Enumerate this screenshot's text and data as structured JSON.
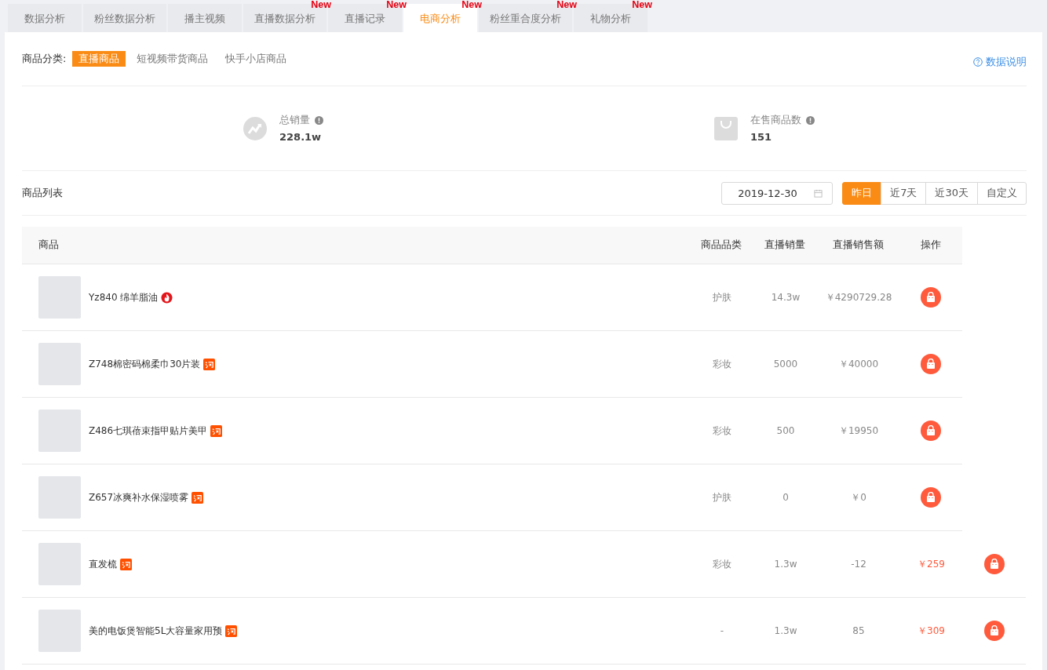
{
  "tabs": [
    {
      "label": "数据分析",
      "selected": false
    },
    {
      "label": "粉丝数据分析",
      "selected": false
    },
    {
      "label": "播主视频",
      "selected": false
    },
    {
      "label": "直播数据分析",
      "selected": false,
      "badge": "New"
    },
    {
      "label": "直播记录",
      "selected": false,
      "badge": "New"
    },
    {
      "label": "电商分析",
      "selected": true,
      "badge": "New"
    },
    {
      "label": "粉丝重合度分析",
      "selected": false,
      "badge": "New"
    },
    {
      "label": "礼物分析",
      "selected": false,
      "badge": "New"
    }
  ],
  "category_filter": {
    "label": "商品分类:",
    "options": [
      {
        "label": "直播商品",
        "selected": true
      },
      {
        "label": "短视频带货商品",
        "selected": false
      },
      {
        "label": "快手小店商品",
        "selected": false
      }
    ]
  },
  "help_link": "数据说明",
  "stats": [
    {
      "kind": "trend",
      "label": "总销量",
      "value": "228.1w"
    },
    {
      "kind": "bag",
      "label": "在售商品数",
      "value": "151"
    }
  ],
  "list": {
    "title": "商品列表",
    "date": "2019-12-30",
    "ranges": [
      {
        "label": "昨日",
        "selected": true
      },
      {
        "label": "近7天",
        "selected": false
      },
      {
        "label": "近30天",
        "selected": false
      },
      {
        "label": "自定义",
        "selected": false
      }
    ]
  },
  "table": {
    "columns": [
      "商品",
      "商品品类",
      "直播销量",
      "直播销售额",
      "操作"
    ],
    "rows": [
      {
        "name": "Yz840 绵羊脂油",
        "kind": "hot",
        "values": [
          "护肤",
          "14.3w",
          "￥4290729.28"
        ],
        "price_highlighted": false
      },
      {
        "name": "Z748棉密码棉柔巾30片装",
        "kind": "shop",
        "values": [
          "彩妆",
          "5000",
          "￥40000"
        ],
        "price_highlighted": false
      },
      {
        "name": "Z486七琪蓓束指甲贴片美甲",
        "kind": "shop",
        "values": [
          "彩妆",
          "500",
          "￥19950"
        ],
        "price_highlighted": false
      },
      {
        "name": "Z657冰爽补水保湿喷雾",
        "kind": "shop",
        "values": [
          "护肤",
          "0",
          "￥0"
        ],
        "price_highlighted": false
      },
      {
        "name": "直发梳",
        "kind": "shop",
        "values": [
          "彩妆",
          "1.3w",
          "-12",
          "￥259"
        ],
        "price_highlighted": true
      },
      {
        "name": "美的电饭煲智能5L大容量家用预",
        "kind": "shop",
        "values": [
          "-",
          "1.3w",
          "85",
          "￥309"
        ],
        "price_highlighted": true
      }
    ]
  }
}
